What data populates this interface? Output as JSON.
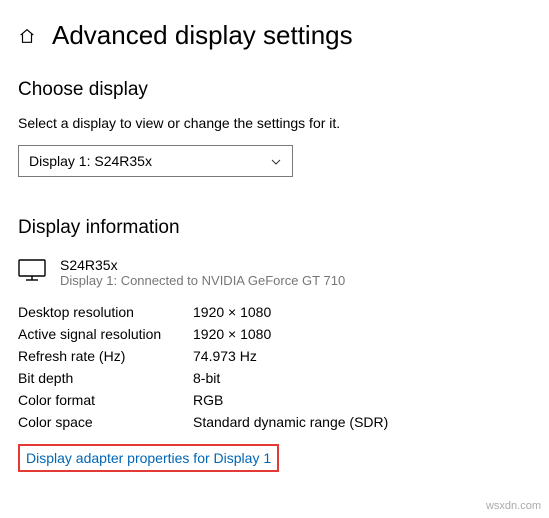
{
  "header": {
    "title": "Advanced display settings"
  },
  "choose": {
    "title": "Choose display",
    "desc": "Select a display to view or change the settings for it.",
    "selected": "Display 1: S24R35x"
  },
  "info": {
    "title": "Display information",
    "monitor_name": "S24R35x",
    "monitor_sub": "Display 1: Connected to NVIDIA GeForce GT 710",
    "rows": [
      {
        "label": "Desktop resolution",
        "value": "1920 × 1080"
      },
      {
        "label": "Active signal resolution",
        "value": "1920 × 1080"
      },
      {
        "label": "Refresh rate (Hz)",
        "value": "74.973 Hz"
      },
      {
        "label": "Bit depth",
        "value": "8-bit"
      },
      {
        "label": "Color format",
        "value": "RGB"
      },
      {
        "label": "Color space",
        "value": "Standard dynamic range (SDR)"
      }
    ],
    "link": "Display adapter properties for Display 1"
  },
  "watermark": "wsxdn.com"
}
